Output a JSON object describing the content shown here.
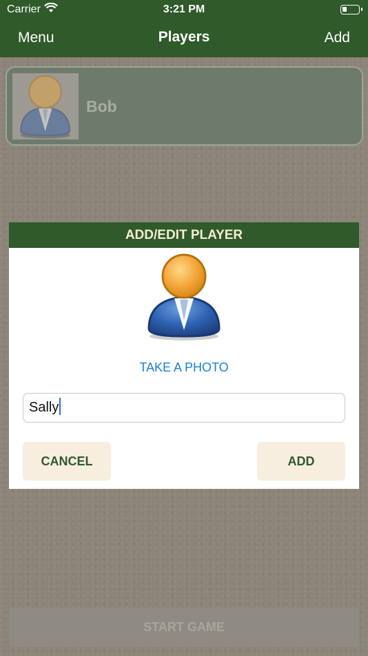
{
  "status_bar": {
    "carrier": "Carrier",
    "time": "3:21 PM"
  },
  "nav": {
    "menu_label": "Menu",
    "title": "Players",
    "add_label": "Add"
  },
  "players": [
    {
      "name": "Bob"
    }
  ],
  "dialog": {
    "title": "ADD/EDIT PLAYER",
    "photo_link": "TAKE A PHOTO",
    "name_value": "Sally",
    "cancel_label": "CANCEL",
    "add_label": "ADD"
  },
  "footer": {
    "start_label": "START GAME"
  },
  "colors": {
    "accent_green": "#2f5a2a",
    "link_blue": "#1a7fd6",
    "button_cream": "#f7eee0"
  },
  "icons": {
    "player_avatar": "person-avatar-icon",
    "wifi": "wifi-icon",
    "battery": "battery-icon"
  }
}
